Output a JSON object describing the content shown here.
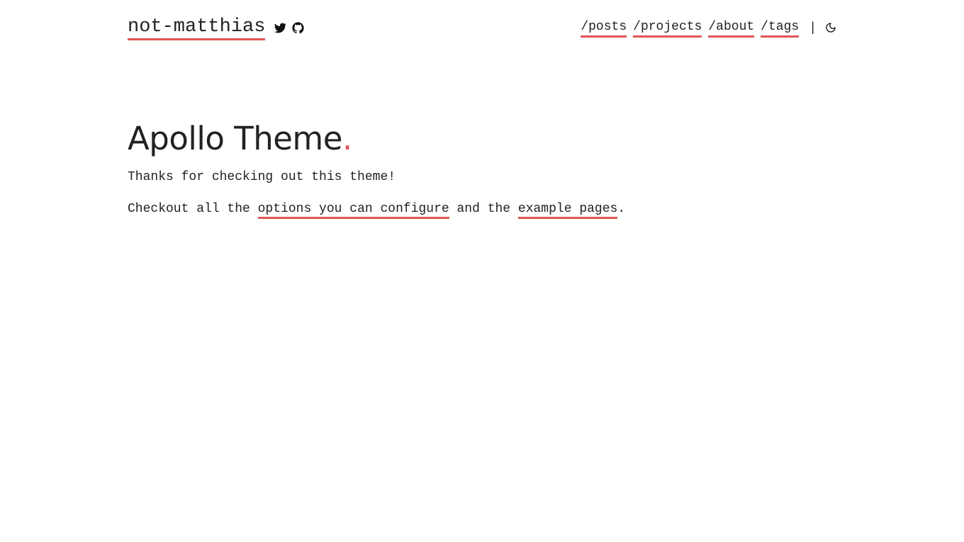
{
  "header": {
    "site_title": "not-matthias",
    "social": [
      {
        "icon": "twitter-icon",
        "label": "Twitter"
      },
      {
        "icon": "github-icon",
        "label": "GitHub"
      }
    ],
    "nav": [
      {
        "label": "/posts"
      },
      {
        "label": "/projects"
      },
      {
        "label": "/about"
      },
      {
        "label": "/tags"
      }
    ],
    "separator": "|",
    "theme_toggle_icon": "moon-icon"
  },
  "main": {
    "title": "Apollo Theme",
    "title_dot": ".",
    "intro": "Thanks for checking out this theme!",
    "line2": {
      "prefix": "Checkout all the ",
      "link1": "options you can configure",
      "middle": " and the ",
      "link2": "example pages",
      "suffix": "."
    }
  },
  "colors": {
    "accent": "#e05555",
    "text": "#222222",
    "background": "#ffffff"
  }
}
